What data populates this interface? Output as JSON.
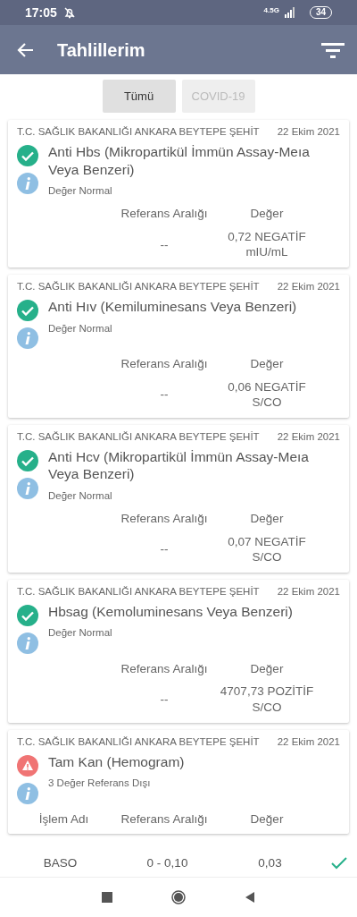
{
  "status_bar": {
    "time": "17:05",
    "network": "4.5G",
    "battery": "34"
  },
  "app_bar": {
    "title": "Tahlillerim"
  },
  "tabs": [
    {
      "label": "Tümü",
      "selected": true
    },
    {
      "label": "COVID-19",
      "selected": false
    }
  ],
  "results": [
    {
      "institution": "T.C. SAĞLIK BAKANLIĞI ANKARA BEYTEPE ŞEHİT",
      "date": "22 Ekim 2021",
      "kind": "normal",
      "title": "Anti Hbs  (Mikropartikül İmmün Assay-Meıa Veya Benzeri)",
      "note": "Değer Normal",
      "columns": [
        "",
        "Referans Aralığı",
        "Değer"
      ],
      "rows": [
        [
          "",
          "--",
          "0,72 NEGATİF mIU/mL"
        ]
      ]
    },
    {
      "institution": "T.C. SAĞLIK BAKANLIĞI ANKARA BEYTEPE ŞEHİT",
      "date": "22 Ekim 2021",
      "kind": "normal",
      "title": "Anti Hıv (Kemiluminesans Veya Benzeri)",
      "note": "Değer Normal",
      "columns": [
        "",
        "Referans Aralığı",
        "Değer"
      ],
      "rows": [
        [
          "",
          "--",
          "0,06 NEGATİF S/CO"
        ]
      ]
    },
    {
      "institution": "T.C. SAĞLIK BAKANLIĞI ANKARA BEYTEPE ŞEHİT",
      "date": "22 Ekim 2021",
      "kind": "normal",
      "title": "Anti Hcv (Mikropartikül İmmün Assay-Meıa Veya Benzeri)",
      "note": "Değer Normal",
      "columns": [
        "",
        "Referans Aralığı",
        "Değer"
      ],
      "rows": [
        [
          "",
          "--",
          "0,07 NEGATİF S/CO"
        ]
      ]
    },
    {
      "institution": "T.C. SAĞLIK BAKANLIĞI ANKARA BEYTEPE ŞEHİT",
      "date": "22 Ekim 2021",
      "kind": "normal",
      "title": "Hbsag (Kemoluminesans Veya Benzeri)",
      "note": "Değer Normal",
      "columns": [
        "",
        "Referans Aralığı",
        "Değer"
      ],
      "rows": [
        [
          "",
          "--",
          "4707,73 POZİTİF S/CO"
        ]
      ]
    },
    {
      "institution": "T.C. SAĞLIK BAKANLIĞI ANKARA BEYTEPE ŞEHİT",
      "date": "22 Ekim 2021",
      "kind": "warning",
      "title": "Tam Kan (Hemogram)",
      "note": "3 Değer Referans Dışı",
      "columns": [
        "İşlem Adı",
        "Referans Aralığı",
        "Değer"
      ]
    }
  ],
  "detail_rows": [
    {
      "name": "BASO",
      "range": "0 - 0,10",
      "value": "0,03",
      "kind": "normal"
    }
  ]
}
